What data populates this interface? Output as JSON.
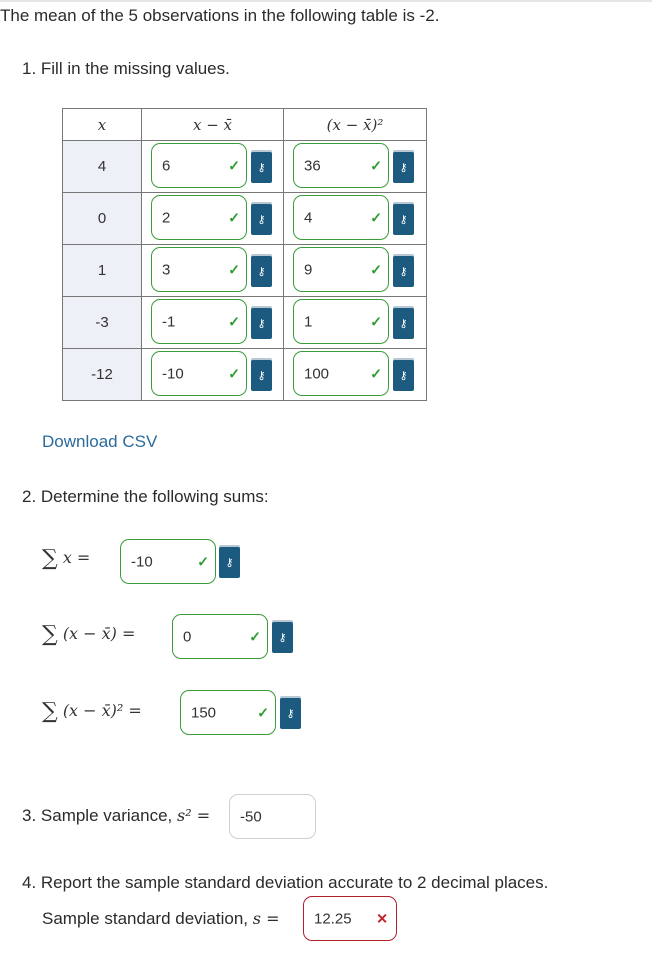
{
  "intro_text": "The mean of the 5 observations in the following table is -2.",
  "question1": "1. Fill in the missing values.",
  "table": {
    "headers": [
      "x",
      "x − x̄",
      "(x − x̄)²"
    ],
    "rows": [
      {
        "x": "4",
        "dev": "6",
        "sq": "36"
      },
      {
        "x": "0",
        "dev": "2",
        "sq": "4"
      },
      {
        "x": "1",
        "dev": "3",
        "sq": "9"
      },
      {
        "x": "-3",
        "dev": "-1",
        "sq": "1"
      },
      {
        "x": "-12",
        "dev": "-10",
        "sq": "100"
      }
    ]
  },
  "download_link": "Download CSV",
  "question2": "2. Determine the following sums:",
  "sums": {
    "sum_x_label": "x =",
    "sum_x_value": "-10",
    "sum_dev_label": "(x − x̄) =",
    "sum_dev_value": "0",
    "sum_sq_label": "(x − x̄)² =",
    "sum_sq_value": "150"
  },
  "question3": {
    "text": "3. Sample variance,",
    "math": "s² =",
    "value": "-50"
  },
  "question4": {
    "text": "4. Report the sample standard deviation accurate to 2 decimal places.",
    "label": "Sample standard deviation,",
    "math": "s =",
    "value": "12.25"
  },
  "icons": {
    "check": "✓",
    "cross": "✕",
    "key": "⚷"
  },
  "colors": {
    "correct_border": "#3a9d3a",
    "incorrect_border": "#b0212a",
    "key_button": "#1c5a80",
    "link": "#2a6b9c"
  }
}
